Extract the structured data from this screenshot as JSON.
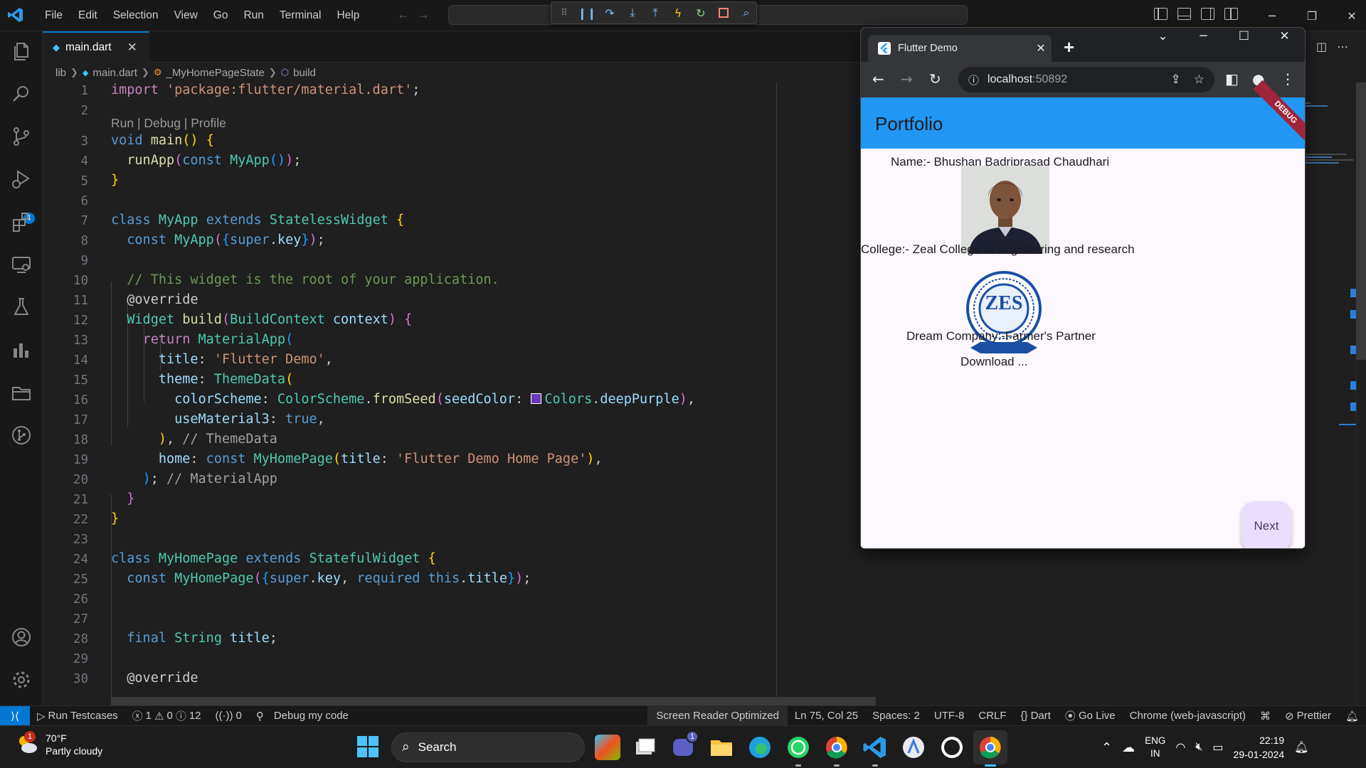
{
  "vscode": {
    "menu": [
      "File",
      "Edit",
      "Selection",
      "View",
      "Go",
      "Run",
      "Terminal",
      "Help"
    ],
    "run_badge": "1",
    "tab": {
      "label": "main.dart"
    },
    "breadcrumb": [
      "lib",
      "main.dart",
      "_MyHomePageState",
      "build"
    ],
    "codelens": "Run | Debug | Profile",
    "line_numbers": [
      "1",
      "2",
      "3",
      "4",
      "5",
      "6",
      "7",
      "8",
      "9",
      "10",
      "11",
      "12",
      "13",
      "14",
      "15",
      "16",
      "17",
      "18",
      "19",
      "20",
      "21",
      "22",
      "23",
      "24",
      "25",
      "26",
      "27",
      "28",
      "29",
      "30"
    ],
    "code": {
      "l1_kw": "import",
      "l1_str": "'package:flutter/material.dart'",
      "l1_end": ";",
      "l3_kw": "void",
      "l3_fn": "main",
      "l3_paren": "()",
      "l3_brace": "{",
      "l4_fn": "runApp",
      "l4_kw": "const",
      "l4_typ": "MyApp",
      "l4_end": ";",
      "l5": "}",
      "l7_kw1": "class",
      "l7_typ1": "MyApp",
      "l7_kw2": "extends",
      "l7_typ2": "StatelessWidget",
      "l7_brace": "{",
      "l8_kw": "const",
      "l8_typ": "MyApp",
      "l8_super": "super",
      "l8_key": "key",
      "l8_end": ";",
      "l10": "// This widget is the root of your application.",
      "l11": "@override",
      "l12_typ": "Widget",
      "l12_fn": "build",
      "l12_typ2": "BuildContext",
      "l12_var": "context",
      "l12_brace": "{",
      "l13_kw": "return",
      "l13_typ": "MaterialApp",
      "l14_var": "title",
      "l14_str": "'Flutter Demo'",
      "l15_var": "theme",
      "l15_typ": "ThemeData",
      "l16_var": "colorScheme",
      "l16_typ": "ColorScheme",
      "l16_fn": "fromSeed",
      "l16_var2": "seedColor",
      "l16_typ2": "Colors",
      "l16_var3": "deepPurple",
      "l17_var": "useMaterial3",
      "l17_kw": "true",
      "l18_cm": "// ThemeData",
      "l19_var": "home",
      "l19_kw": "const",
      "l19_typ": "MyHomePage",
      "l19_var2": "title",
      "l19_str": "'Flutter Demo Home Page'",
      "l20_cm": "// MaterialApp",
      "l21": "}",
      "l22": "}",
      "l24_kw1": "class",
      "l24_typ1": "MyHomePage",
      "l24_kw2": "extends",
      "l24_typ2": "StatefulWidget",
      "l24_brace": "{",
      "l25_kw": "const",
      "l25_typ": "MyHomePage",
      "l25_super": "super",
      "l25_key": "key",
      "l25_req": "required",
      "l25_this": "this",
      "l25_title": "title",
      "l28_kw": "final",
      "l28_typ": "String",
      "l28_var": "title",
      "l30": "@override"
    },
    "status": {
      "run_testcases": "Run Testcases",
      "errors": "1",
      "warnings": "0",
      "infos": "12",
      "ports": "0",
      "debug_my_code": "Debug my code",
      "screen_reader": "Screen Reader Optimized",
      "position": "Ln 75, Col 25",
      "spaces": "Spaces: 2",
      "encoding": "UTF-8",
      "eol": "CRLF",
      "language": "Dart",
      "go_live": "Go Live",
      "device": "Chrome (web-javascript)",
      "prettier": "Prettier"
    }
  },
  "chrome": {
    "tab_title": "Flutter Demo",
    "url_host": "localhost",
    "url_port": ":50892"
  },
  "flutter_app": {
    "appbar_title": "Portfolio",
    "debug_banner": "DEBUG",
    "name": "Name:- Bhushan Badriprasad Chaudhari",
    "college": "College:- Zeal College of engineering and research",
    "logo_text": "ZES",
    "dream_company": "Dream Company:-Farmer's Partner",
    "download": "Download ...",
    "next_button": "Next"
  },
  "taskbar": {
    "temperature": "70°F",
    "weather": "Partly cloudy",
    "weather_badge": "1",
    "search": "Search",
    "teams_badge": "1",
    "lang_top": "ENG",
    "lang_bottom": "IN",
    "time": "22:19",
    "date": "29-01-2024"
  }
}
